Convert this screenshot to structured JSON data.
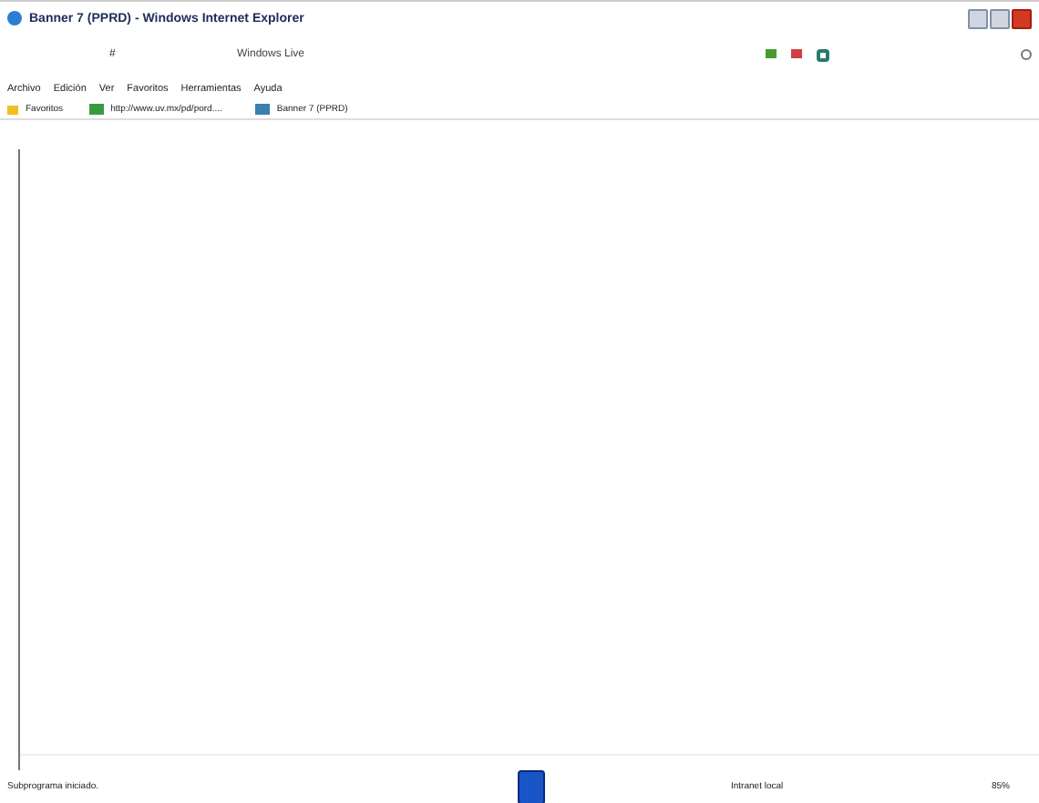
{
  "window": {
    "title": "Banner 7 (PPRD) - Windows Internet Explorer"
  },
  "address_bar": {
    "value": "#"
  },
  "search": {
    "placeholder": "Windows Live"
  },
  "menu": [
    "Archivo",
    "Edición",
    "Ver",
    "Favoritos",
    "Herramientas",
    "Ayuda"
  ],
  "favorites_bar": {
    "label": "Favoritos",
    "link": "http://www.uv.mx/pd/pord....",
    "tab": "Banner 7 (PPRD)"
  },
  "status_bar": {
    "message": "Subprograma iniciado.",
    "zone": "Intranet local",
    "zoom": "85%"
  }
}
